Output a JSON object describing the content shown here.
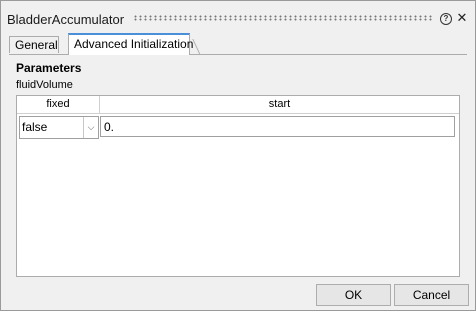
{
  "window": {
    "title": "BladderAccumulator"
  },
  "titlebar_icons": {
    "help": "help-icon",
    "close": "close-icon",
    "help_glyph": "?",
    "close_glyph": "✕"
  },
  "tabs": [
    {
      "label": "General",
      "active": false
    },
    {
      "label": "Advanced Initialization",
      "active": true
    }
  ],
  "panel": {
    "section_title": "Parameters",
    "group_label": "fluidVolume",
    "table": {
      "columns": [
        "fixed",
        "start"
      ],
      "rows": [
        {
          "fixed": "false",
          "start": "0."
        }
      ]
    }
  },
  "buttons": {
    "ok_label": "OK",
    "cancel_label": "Cancel"
  },
  "colors": {
    "active_tab_accent": "#4a8fd9"
  }
}
